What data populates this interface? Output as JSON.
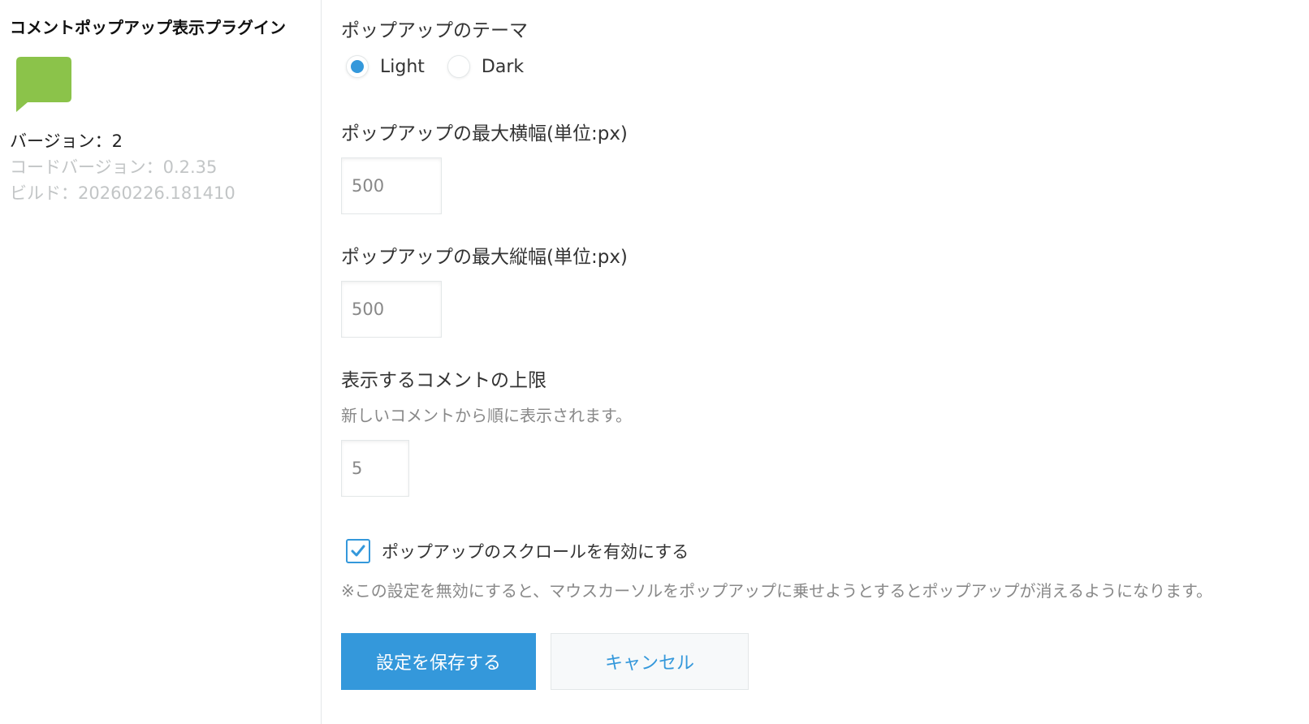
{
  "sidebar": {
    "plugin_name": "コメントポップアップ表示プラグイン",
    "icon": "speech-bubble-icon",
    "icon_color": "#8bc34a",
    "version": "バージョン：2",
    "code_version": "コードバージョン：0.2.35",
    "build": "ビルド：20260226.181410"
  },
  "settings": {
    "theme": {
      "label": "ポップアップのテーマ",
      "options": [
        {
          "label": "Light",
          "selected": true
        },
        {
          "label": "Dark",
          "selected": false
        }
      ]
    },
    "max_width": {
      "label": "ポップアップの最大横幅(単位:px)",
      "value": "500"
    },
    "max_height": {
      "label": "ポップアップの最大縦幅(単位:px)",
      "value": "500"
    },
    "comment_limit": {
      "label": "表示するコメントの上限",
      "description": "新しいコメントから順に表示されます。",
      "value": "5"
    },
    "scroll": {
      "label": "ポップアップのスクロールを有効にする",
      "checked": true,
      "note": "※この設定を無効にすると、マウスカーソルをポップアップに乗せようとするとポップアップが消えるようになります。"
    }
  },
  "buttons": {
    "save_label": "設定を保存する",
    "cancel_label": "キャンセル"
  },
  "colors": {
    "accent": "#3498db",
    "border": "#e3e7e8",
    "muted_text": "#888888",
    "disabled_text": "#c2c5c6"
  }
}
